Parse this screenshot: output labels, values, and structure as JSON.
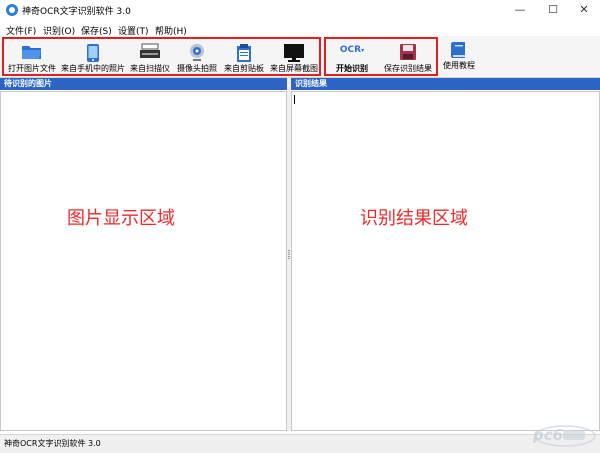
{
  "window": {
    "title": "神奇OCR文字识别软件 3.0",
    "minimize": "—",
    "maximize": "☐",
    "close": "✕"
  },
  "menu": [
    {
      "label": "文件(F)"
    },
    {
      "label": "识别(O)"
    },
    {
      "label": "保存(S)"
    },
    {
      "label": "设置(T)"
    },
    {
      "label": "帮助(H)"
    }
  ],
  "toolbar": {
    "open_file": "打开图片文件",
    "from_phone": "来自手机中的照片",
    "from_scanner": "来自扫描仪",
    "from_camera": "摄像头拍照",
    "from_clipboard": "来自剪贴板",
    "screenshot": "来自屏幕截图",
    "ocr_icon_text": "OCR",
    "start_ocr": "开始识别",
    "save_result": "保存识别结果",
    "tutorial": "使用教程"
  },
  "left_panel": {
    "header": "待识别的图片",
    "area_label": "图片显示区域"
  },
  "right_panel": {
    "header": "识别结果",
    "area_label": "识别结果区域"
  },
  "status": {
    "text": "神奇OCR文字识别软件 3.0"
  },
  "watermark": {
    "text": "pc6"
  },
  "colors": {
    "highlight_border": "#e02020",
    "panel_header": "#2c64c4",
    "area_label": "#ee2a2a"
  }
}
